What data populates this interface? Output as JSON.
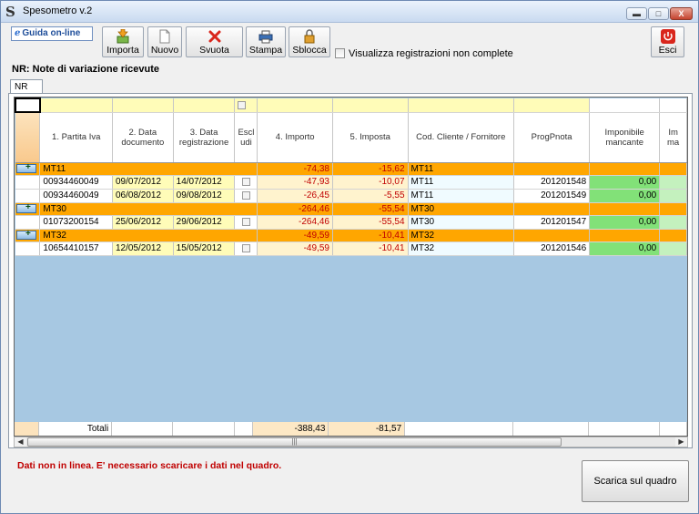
{
  "window": {
    "title": "Spesometro v.2",
    "minimize": "▬",
    "maximize": "□",
    "close": "X"
  },
  "toolbar": {
    "guida_label": "Guida on-line",
    "importa_label": "Importa",
    "nuovo_label": "Nuovo",
    "svuota_label": "Svuota",
    "stampa_label": "Stampa",
    "sblocca_label": "Sblocca",
    "checkbox_label": "Visualizza registrazioni non complete",
    "esci_label": "Esci"
  },
  "section_title": "NR: Note di variazione ricevute",
  "tab_label": "NR",
  "columns": [
    "1. Partita Iva",
    "2. Data documento",
    "3. Data registrazione",
    "Escl udi",
    "4. Importo",
    "5. Imposta",
    "Cod. Cliente / Fornitore",
    "ProgPnota",
    "Imponibile mancante",
    "Im ma"
  ],
  "groups": [
    {
      "code": "MT11",
      "importo": "-74,38",
      "imposta": "-15,62",
      "rows": [
        {
          "piva": "00934460049",
          "data_doc": "09/07/2012",
          "data_reg": "14/07/2012",
          "importo": "-47,93",
          "imposta": "-10,07",
          "cod": "MT11",
          "prog": "201201548",
          "imp_manc": "0,00"
        },
        {
          "piva": "00934460049",
          "data_doc": "06/08/2012",
          "data_reg": "09/08/2012",
          "importo": "-26,45",
          "imposta": "-5,55",
          "cod": "MT11",
          "prog": "201201549",
          "imp_manc": "0,00"
        }
      ]
    },
    {
      "code": "MT30",
      "importo": "-264,46",
      "imposta": "-55,54",
      "rows": [
        {
          "piva": "01073200154",
          "data_doc": "25/06/2012",
          "data_reg": "29/06/2012",
          "importo": "-264,46",
          "imposta": "-55,54",
          "cod": "MT30",
          "prog": "201201547",
          "imp_manc": "0,00"
        }
      ]
    },
    {
      "code": "MT32",
      "importo": "-49,59",
      "imposta": "-10,41",
      "rows": [
        {
          "piva": "10654410157",
          "data_doc": "12/05/2012",
          "data_reg": "15/05/2012",
          "importo": "-49,59",
          "imposta": "-10,41",
          "cod": "MT32",
          "prog": "201201546",
          "imp_manc": "0,00"
        }
      ]
    }
  ],
  "totals": {
    "label": "Totali",
    "importo": "-388,43",
    "imposta": "-81,57"
  },
  "status_message": "Dati non in linea. E' necessario scaricare i dati nel quadro.",
  "scarica_label": "Scarica sul quadro",
  "colors": {
    "group_orange": "#ffa600",
    "filter_yellow": "#fffcb8",
    "green": "#82e178",
    "red_text": "#c00000",
    "grid_bg": "#a7c8e2"
  }
}
